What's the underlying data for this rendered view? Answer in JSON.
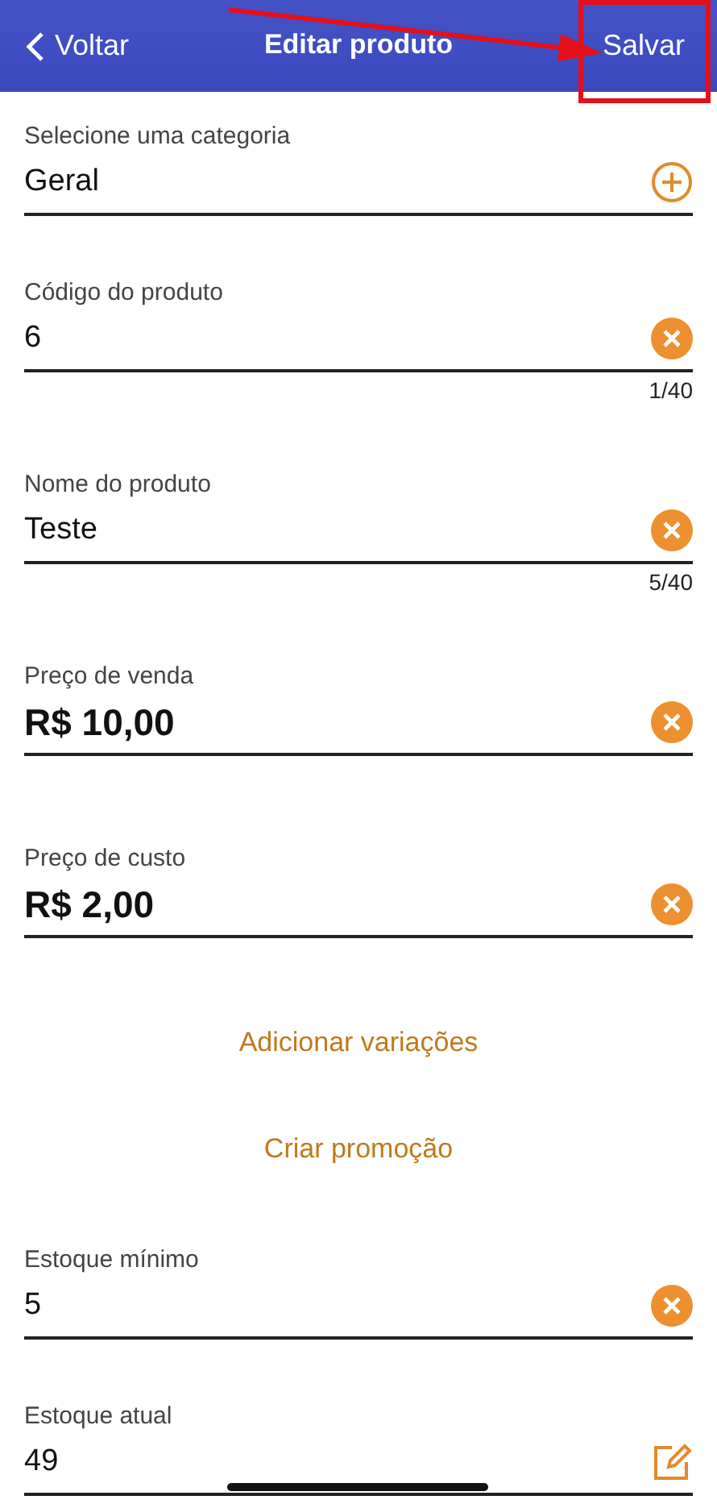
{
  "header": {
    "back_label": "Voltar",
    "title": "Editar produto",
    "action_label": "Salvar"
  },
  "fields": [
    {
      "label": "Selecione uma categoria",
      "value": "Geral",
      "kind": "add",
      "large": false
    },
    {
      "label": "Código do produto",
      "value": "6",
      "kind": "clear",
      "large": false,
      "counter": "1/40"
    },
    {
      "label": "Nome do produto",
      "value": "Teste",
      "kind": "clear",
      "large": false,
      "counter": "5/40"
    },
    {
      "label": "Preço de venda",
      "value": "R$ 10,00",
      "kind": "clear",
      "large": true
    },
    {
      "label": "Preço de custo",
      "value": "R$ 2,00",
      "kind": "clear",
      "large": true
    }
  ],
  "actions": [
    "Adicionar variações",
    "Criar promoção"
  ],
  "stock_fields": [
    {
      "label": "Estoque mínimo",
      "value": "5",
      "kind": "clear",
      "large": false
    },
    {
      "label": "Estoque atual",
      "value": "49",
      "kind": "edit",
      "large": false
    }
  ]
}
